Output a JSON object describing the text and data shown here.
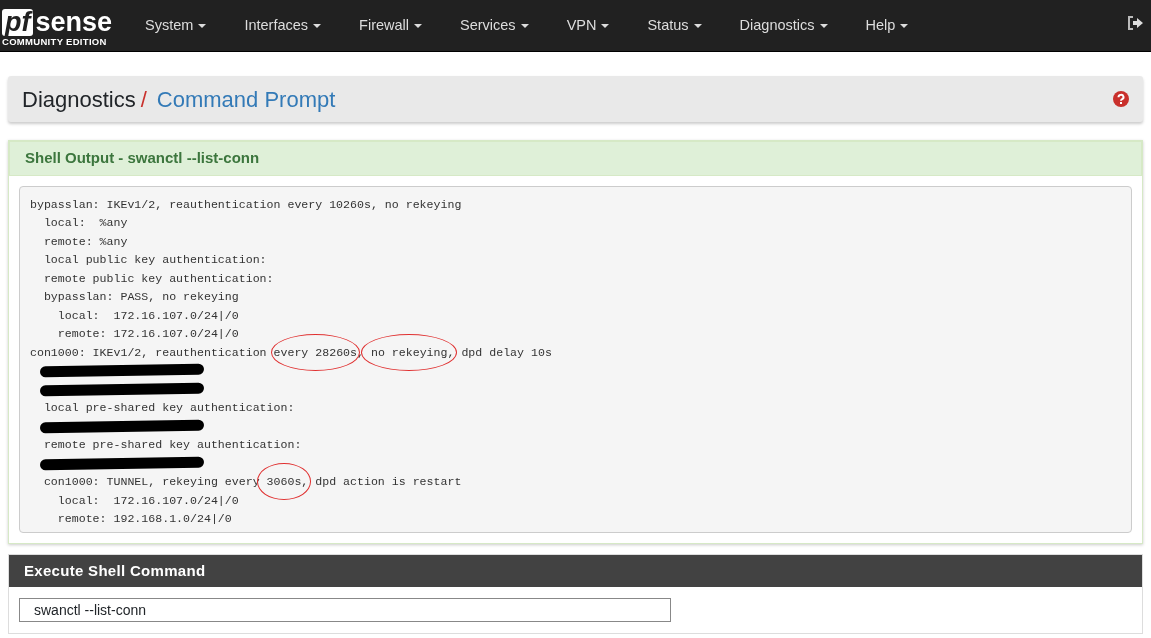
{
  "navbar": {
    "brand": "sense",
    "brand_mark": "pf",
    "edition": "COMMUNITY EDITION",
    "menus": [
      {
        "label": "System"
      },
      {
        "label": "Interfaces"
      },
      {
        "label": "Firewall"
      },
      {
        "label": "Services"
      },
      {
        "label": "VPN"
      },
      {
        "label": "Status"
      },
      {
        "label": "Diagnostics"
      },
      {
        "label": "Help"
      }
    ]
  },
  "breadcrumb": {
    "parent": "Diagnostics",
    "separator": "/",
    "current": "Command Prompt"
  },
  "output_panel": {
    "title": "Shell Output - swanctl --list-conn",
    "lines": [
      {
        "kind": "text",
        "segments": [
          {
            "text": "bypasslan: IKEv1/2, reauthentication every 10260s, no rekeying",
            "circled": false
          }
        ]
      },
      {
        "kind": "text",
        "segments": [
          {
            "text": "  local:  %any",
            "circled": false
          }
        ]
      },
      {
        "kind": "text",
        "segments": [
          {
            "text": "  remote: %any",
            "circled": false
          }
        ]
      },
      {
        "kind": "text",
        "segments": [
          {
            "text": "  local public key authentication:",
            "circled": false
          }
        ]
      },
      {
        "kind": "text",
        "segments": [
          {
            "text": "  remote public key authentication:",
            "circled": false
          }
        ]
      },
      {
        "kind": "text",
        "segments": [
          {
            "text": "  bypasslan: PASS, no rekeying",
            "circled": false
          }
        ]
      },
      {
        "kind": "text",
        "segments": [
          {
            "text": "    local:  172.16.107.0/24|/0",
            "circled": false
          }
        ]
      },
      {
        "kind": "text",
        "segments": [
          {
            "text": "    remote: 172.16.107.0/24|/0",
            "circled": false
          }
        ]
      },
      {
        "kind": "text",
        "segments": [
          {
            "text": "con1000: IKEv1/2, reauthentication ",
            "circled": false
          },
          {
            "text": "every 28260s",
            "circled": true
          },
          {
            "text": ",",
            "circled": false
          },
          {
            "text": " no rekeying,",
            "circled": true
          },
          {
            "text": " dpd delay 10s",
            "circled": false
          }
        ]
      },
      {
        "kind": "redacted"
      },
      {
        "kind": "redacted"
      },
      {
        "kind": "text",
        "segments": [
          {
            "text": "  local pre-shared key authentication:",
            "circled": false
          }
        ]
      },
      {
        "kind": "redacted"
      },
      {
        "kind": "text",
        "segments": [
          {
            "text": "  remote pre-shared key authentication:",
            "circled": false
          }
        ]
      },
      {
        "kind": "redacted"
      },
      {
        "kind": "text",
        "segments": [
          {
            "text": "  con1000: TUNNEL, rekeying every",
            "circled": false
          },
          {
            "text": " 3060s,",
            "circled": true
          },
          {
            "text": " dpd action is restart",
            "circled": false
          }
        ]
      },
      {
        "kind": "text",
        "segments": [
          {
            "text": "    local:  172.16.107.0/24|/0",
            "circled": false
          }
        ]
      },
      {
        "kind": "text",
        "segments": [
          {
            "text": "    remote: 192.168.1.0/24|/0",
            "circled": false
          }
        ]
      }
    ]
  },
  "command_panel": {
    "title": "Execute Shell Command",
    "command": "swanctl --list-conn"
  }
}
